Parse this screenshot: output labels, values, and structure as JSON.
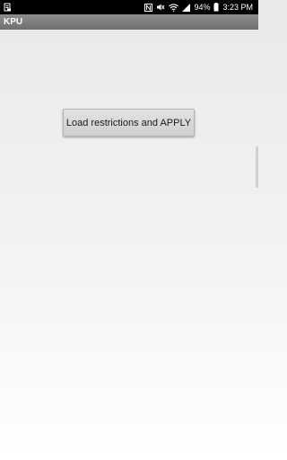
{
  "status_bar": {
    "battery_percent": "94%",
    "time": "3:23 PM",
    "icons": [
      "notification-icon",
      "nfc-icon",
      "mute-icon",
      "wifi-icon",
      "signal-icon",
      "battery-icon"
    ]
  },
  "app": {
    "title": "KPU"
  },
  "main": {
    "load_button_label": "Load restrictions and APPLY"
  },
  "colors": {
    "title_bar": "#7d7d7d",
    "button": "#d8d8d8"
  }
}
